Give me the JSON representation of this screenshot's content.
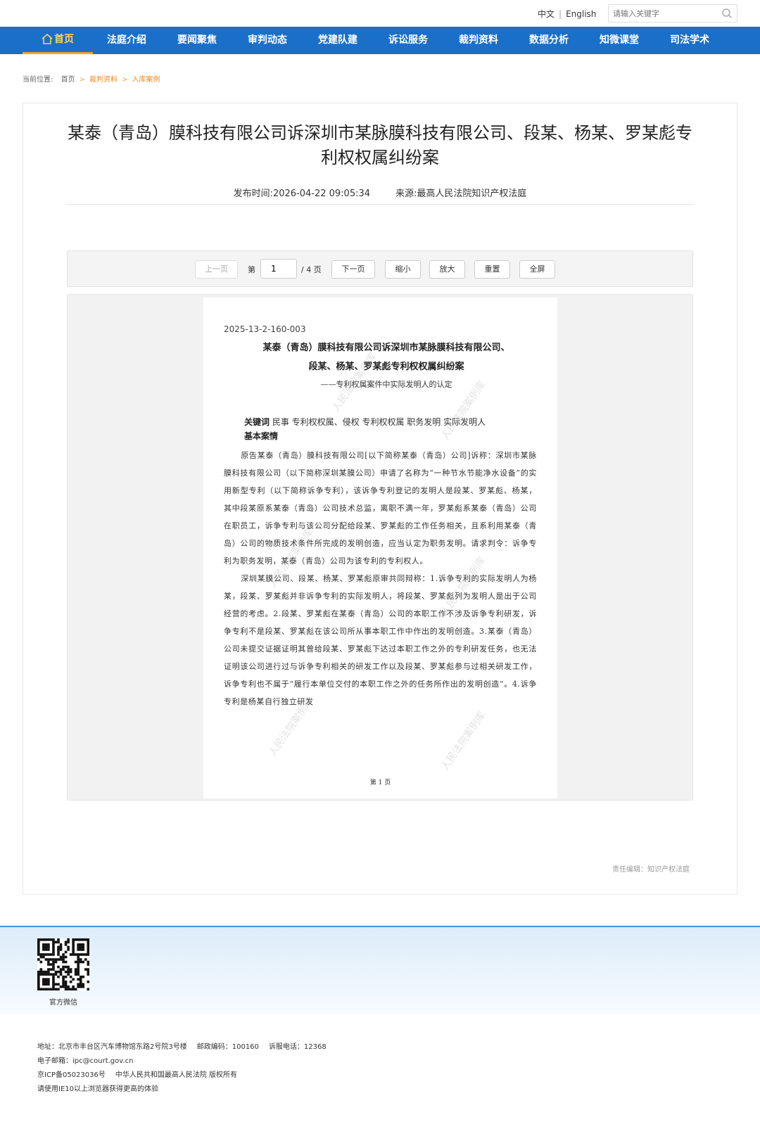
{
  "header": {
    "lang_cn": "中文",
    "lang_en": "English",
    "search_placeholder": "请输入关键字"
  },
  "nav": {
    "items": [
      "首页",
      "法庭介绍",
      "要闻聚焦",
      "审判动态",
      "党建队建",
      "诉讼服务",
      "裁判资料",
      "数据分析",
      "知微课堂",
      "司法学术"
    ]
  },
  "breadcrumb": {
    "label": "当前位置:",
    "items": [
      "首页",
      "裁判资料",
      "入库案例"
    ]
  },
  "article": {
    "title": "某泰（青岛）膜科技有限公司诉深圳市某脉膜科技有限公司、段某、杨某、罗某彪专利权权属纠纷案",
    "publish_label": "发布时间:",
    "publish_time": "2026-04-22 09:05:34",
    "source_label": "来源:",
    "source": "最高人民法院知识产权法庭",
    "editor": "责任编辑：知识产权法庭"
  },
  "viewer_toolbar": {
    "prev": "上一页",
    "page_prefix": "第",
    "page_value": "1",
    "page_total": "/ 4 页",
    "next": "下一页",
    "zoom_out": "缩小",
    "zoom_in": "放大",
    "reset": "重置",
    "fullscreen": "全屏"
  },
  "document_page": {
    "code": "2025-13-2-160-003",
    "title_line1": "某泰（青岛）膜科技有限公司诉深圳市某脉膜科技有限公司、",
    "title_line2": "段某、杨某、罗某彪专利权权属纠纷案",
    "subtitle": "——专利权属案件中实际发明人的认定",
    "keywords_label": "关键词",
    "keywords": "民事 专利权权属、侵权 专利权权属 职务发明 实际发明人",
    "section": "基本案情",
    "para1": "原告某泰（青岛）膜科技有限公司[以下简称某泰（青岛）公司]诉称：深圳市某脉膜科技有限公司（以下简称深圳某膜公司）申请了名称为“一种节水节能净水设备”的实用新型专利（以下简称诉争专利），该诉争专利登记的发明人是段某、罗某彪、杨某，其中段某原系某泰（青岛）公司技术总监，离职不满一年，罗某彪系某泰（青岛）公司在职员工，诉争专利与该公司分配给段某、罗某彪的工作任务相关，且系利用某泰（青岛）公司的物质技术条件所完成的发明创造，应当认定为职务发明。请求判令：诉争专利为职务发明，某泰（青岛）公司为该专利的专利权人。",
    "para2": "深圳某膜公司、段某、杨某、罗某彪原审共同辩称：1.诉争专利的实际发明人为杨某，段某、罗某彪并非诉争专利的实际发明人，将段某、罗某彪列为发明人是出于公司经营的考虑。2.段某、罗某彪在某泰（青岛）公司的本职工作不涉及诉争专利研发，诉争专利不是段某、罗某彪在该公司所从事本职工作中作出的发明创造。3.某泰（青岛）公司未提交证据证明其曾给段某、罗某彪下达过本职工作之外的专利研发任务，也无法证明该公司进行过与诉争专利相关的研发工作以及段某、罗某彪参与过相关研发工作，诉争专利也不属于“履行本单位交付的本职工作之外的任务所作出的发明创造”。4.诉争专利是杨某自行独立研发",
    "page_footer": "第 1 页",
    "watermark": "人民法院案例库"
  },
  "footer": {
    "qr_label": "官方微信",
    "address": "地址：北京市丰台区汽车博物馆东路2号院3号楼",
    "postcode": "邮政编码：100160",
    "phone": "诉服电话：12368",
    "email": "电子邮箱：ipc@court.gov.cn",
    "icp": "京ICP备05023036号",
    "copyright": "中华人民共和国最高人民法院 版权所有",
    "browser_note": "请使用IE10以上浏览器获得更高的体验"
  },
  "colors": {
    "nav_bg": "#1a6fc9",
    "nav_active": "#ffd54a",
    "accent_orange": "#f08a24"
  }
}
